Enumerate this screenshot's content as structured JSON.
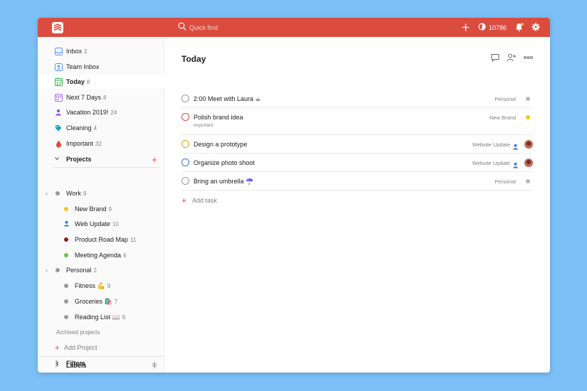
{
  "topbar": {
    "search_placeholder": "Quick find",
    "karma": "10786",
    "accent": "#db4c3f"
  },
  "sidebar": {
    "items": [
      {
        "label": "Inbox",
        "count": "2",
        "icon": "inbox-icon"
      },
      {
        "label": "Team Inbox",
        "count": "",
        "icon": "team-inbox-icon"
      },
      {
        "label": "Today",
        "count": "8",
        "icon": "calendar-today-icon"
      },
      {
        "label": "Next 7 Days",
        "count": "8",
        "icon": "calendar-week-icon"
      },
      {
        "label": "Vacation 2019!",
        "count": "24",
        "icon": "person-icon"
      },
      {
        "label": "Cleaning",
        "count": "4",
        "icon": "tag-icon"
      },
      {
        "label": "Important",
        "count": "32",
        "icon": "drop-icon"
      }
    ],
    "projects_label": "Projects",
    "projects": [
      {
        "label": "Work",
        "count": "9",
        "color": "#999999",
        "level": 0,
        "expandable": true
      },
      {
        "label": "New Brand",
        "count": "9",
        "color": "#f5c518",
        "level": 1
      },
      {
        "label": "Web Update",
        "count": "10",
        "color": "#4073d6",
        "level": 1,
        "icon": "person-icon"
      },
      {
        "label": "Product Road Map",
        "count": "11",
        "color": "#8a1f1f",
        "level": 1
      },
      {
        "label": "Meeting Agenda",
        "count": "6",
        "color": "#6ac34e",
        "level": 1
      },
      {
        "label": "Personal",
        "count": "2",
        "color": "#999999",
        "level": 0,
        "expandable": true
      },
      {
        "label": "Fitness 💪",
        "count": "9",
        "color": "#999999",
        "level": 1
      },
      {
        "label": "Groceries 🛍️",
        "count": "7",
        "color": "#999999",
        "level": 1
      },
      {
        "label": "Reading List 📖",
        "count": "6",
        "color": "#999999",
        "level": 1
      }
    ],
    "archived_label": "Archived projects",
    "add_project_label": "Add Project",
    "labels_label": "Labels",
    "filters_label": "Filters"
  },
  "main": {
    "title": "Today",
    "tasks": [
      {
        "text": "2:00 Meet with Laura ☕",
        "project": "Personal",
        "color": "#b8b8b8",
        "priority_color": "#9a9a9a"
      },
      {
        "text": "Polish brand idea",
        "sub": "Important",
        "project": "New Brand",
        "color": "#f5c518",
        "priority_color": "#db4c3f"
      },
      {
        "text": "Design a prototype",
        "project": "Website Update",
        "color": "#4073d6",
        "priority_color": "#e8a317",
        "assigned": true
      },
      {
        "text": "Organize photo shoot",
        "project": "Website Update",
        "color": "#4073d6",
        "priority_color": "#4073d6",
        "assigned": true
      },
      {
        "text": "Bring an umbrella ☂️",
        "project": "Personal",
        "color": "#b8b8b8",
        "priority_color": "#9a9a9a"
      }
    ],
    "add_task_label": "Add task"
  }
}
